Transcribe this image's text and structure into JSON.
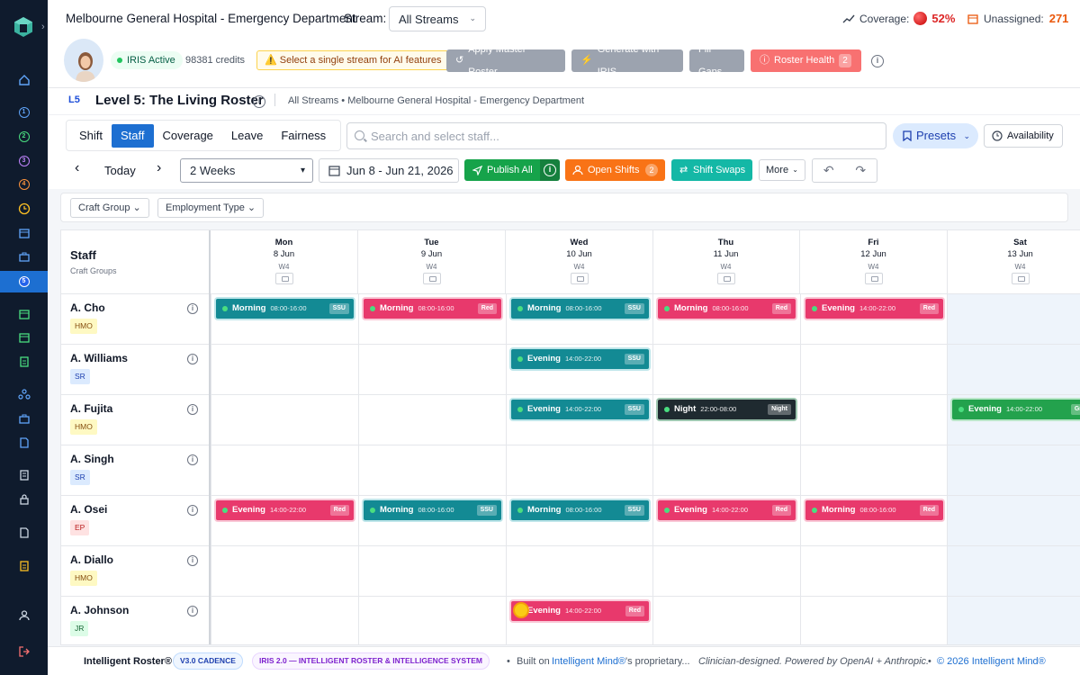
{
  "header": {
    "title": "Melbourne General Hospital - Emergency Department",
    "stream_label": "Stream:",
    "stream_value": "All Streams",
    "coverage_label": "Coverage:",
    "coverage_value": "52%",
    "unassigned_label": "Unassigned:",
    "unassigned_value": "271"
  },
  "toolbar": {
    "iris_status": "IRIS Active",
    "credits": "98381 credits",
    "warning": "Select a single stream for AI features",
    "apply_master": "Apply Master Roster",
    "generate": "Generate with IRIS",
    "fill_gaps": "Fill Gaps",
    "roster_health": "Roster Health",
    "roster_health_count": "2"
  },
  "level": {
    "code": "L5",
    "title": "Level 5: The Living Roster",
    "breadcrumb": "All Streams • Melbourne General Hospital - Emergency Department"
  },
  "tabs": [
    "Shift",
    "Staff",
    "Coverage",
    "Leave",
    "Fairness"
  ],
  "active_tab": "Staff",
  "search": {
    "placeholder": "Search and select staff..."
  },
  "presets_label": "Presets",
  "availability_label": "Availability",
  "nav": {
    "today": "Today",
    "period": "2 Weeks",
    "date_range": "Jun 8 - Jun 21, 2026",
    "publish": "Publish All",
    "open_shifts": "Open Shifts",
    "open_shifts_count": "2",
    "shift_swaps": "Shift Swaps",
    "more": "More"
  },
  "filters": [
    "Craft Group",
    "Employment Type"
  ],
  "grid": {
    "staff_header": "Staff",
    "staff_subheader": "Craft Groups",
    "days": [
      {
        "name": "Mon",
        "date": "8 Jun",
        "week": "W4"
      },
      {
        "name": "Tue",
        "date": "9 Jun",
        "week": "W4"
      },
      {
        "name": "Wed",
        "date": "10 Jun",
        "week": "W4"
      },
      {
        "name": "Thu",
        "date": "11 Jun",
        "week": "W4"
      },
      {
        "name": "Fri",
        "date": "12 Jun",
        "week": "W4"
      },
      {
        "name": "Sat",
        "date": "13 Jun",
        "week": "W4"
      }
    ],
    "staff": [
      {
        "name": "A. Cho",
        "tag": "HMO",
        "tag_color": "#fef9c3",
        "tag_text": "#854d0e",
        "shifts": [
          {
            "day": 0,
            "label": "Morning",
            "time": "08:00-16:00",
            "tag": "SSU",
            "color": "teal"
          },
          {
            "day": 1,
            "label": "Morning",
            "time": "08:00-16:00",
            "tag": "Red",
            "color": "pink"
          },
          {
            "day": 2,
            "label": "Morning",
            "time": "08:00-16:00",
            "tag": "SSU",
            "color": "teal"
          },
          {
            "day": 3,
            "label": "Morning",
            "time": "08:00-16:00",
            "tag": "Red",
            "color": "pink"
          },
          {
            "day": 4,
            "label": "Evening",
            "time": "14:00-22:00",
            "tag": "Red",
            "color": "pink"
          }
        ]
      },
      {
        "name": "A. Williams",
        "tag": "SR",
        "tag_color": "#dbeafe",
        "tag_text": "#1e40af",
        "shifts": [
          {
            "day": 2,
            "label": "Evening",
            "time": "14:00-22:00",
            "tag": "SSU",
            "color": "teal"
          }
        ]
      },
      {
        "name": "A. Fujita",
        "tag": "HMO",
        "tag_color": "#fef9c3",
        "tag_text": "#854d0e",
        "shifts": [
          {
            "day": 2,
            "label": "Evening",
            "time": "14:00-22:00",
            "tag": "SSU",
            "color": "teal"
          },
          {
            "day": 3,
            "label": "Night",
            "time": "22:00-08:00",
            "tag": "Night",
            "color": "dark"
          },
          {
            "day": 5,
            "label": "Evening",
            "time": "14:00-22:00",
            "tag": "Gr",
            "color": "green"
          }
        ]
      },
      {
        "name": "A. Singh",
        "tag": "SR",
        "tag_color": "#dbeafe",
        "tag_text": "#1e40af",
        "shifts": []
      },
      {
        "name": "A. Osei",
        "tag": "EP",
        "tag_color": "#fee2e2",
        "tag_text": "#b91c1c",
        "shifts": [
          {
            "day": 0,
            "label": "Evening",
            "time": "14:00-22:00",
            "tag": "Red",
            "color": "pink"
          },
          {
            "day": 1,
            "label": "Morning",
            "time": "08:00-16:00",
            "tag": "SSU",
            "color": "teal"
          },
          {
            "day": 2,
            "label": "Morning",
            "time": "08:00-16:00",
            "tag": "SSU",
            "color": "teal"
          },
          {
            "day": 3,
            "label": "Evening",
            "time": "14:00-22:00",
            "tag": "Red",
            "color": "pink"
          },
          {
            "day": 4,
            "label": "Morning",
            "time": "08:00-16:00",
            "tag": "Red",
            "color": "pink"
          }
        ]
      },
      {
        "name": "A. Diallo",
        "tag": "HMO",
        "tag_color": "#fef9c3",
        "tag_text": "#854d0e",
        "shifts": []
      },
      {
        "name": "A. Johnson",
        "tag": "JR",
        "tag_color": "#dcfce7",
        "tag_text": "#166534",
        "shifts": [
          {
            "day": 2,
            "label": "Evening",
            "time": "14:00-22:00",
            "tag": "Red",
            "color": "pink",
            "warning": true
          }
        ]
      }
    ]
  },
  "footer": {
    "brand": "Intelligent Roster®",
    "version": "V3.0 CADENCE",
    "system": "IRIS 2.0 — INTELLIGENT ROSTER & INTELLIGENCE SYSTEM",
    "built_prefix": "Built on",
    "built_link": "Intelligent Mind®",
    "built_suffix": "'s proprietary...",
    "tagline": "Clinician-designed. Powered by OpenAI + Anthropic.",
    "copyright": "© 2026 Intelligent Mind®"
  },
  "sidebar": {
    "numbered_items": [
      "1",
      "2",
      "3",
      "4",
      "5"
    ],
    "active_item": "5"
  }
}
